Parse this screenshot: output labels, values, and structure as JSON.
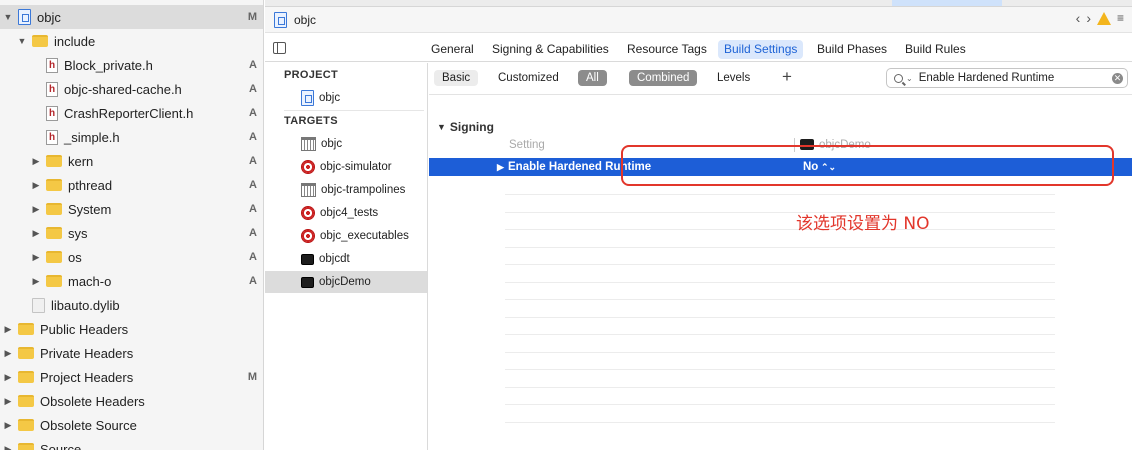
{
  "navigator": {
    "items": [
      {
        "label": "objc",
        "badge": "M",
        "icon": "project-icon",
        "indent": 0,
        "disclosure": "▼",
        "selected": true
      },
      {
        "label": "include",
        "badge": "",
        "icon": "folder-icon",
        "indent": 1,
        "disclosure": "▼"
      },
      {
        "label": "Block_private.h",
        "badge": "A",
        "icon": "header-file-icon",
        "indent": 2,
        "disclosure": ""
      },
      {
        "label": "objc-shared-cache.h",
        "badge": "A",
        "icon": "header-file-icon",
        "indent": 2,
        "disclosure": ""
      },
      {
        "label": "CrashReporterClient.h",
        "badge": "A",
        "icon": "header-file-icon",
        "indent": 2,
        "disclosure": ""
      },
      {
        "label": "_simple.h",
        "badge": "A",
        "icon": "header-file-icon",
        "indent": 2,
        "disclosure": ""
      },
      {
        "label": "kern",
        "badge": "A",
        "icon": "folder-icon",
        "indent": 2,
        "disclosure": "▶"
      },
      {
        "label": "pthread",
        "badge": "A",
        "icon": "folder-icon",
        "indent": 2,
        "disclosure": "▶"
      },
      {
        "label": "System",
        "badge": "A",
        "icon": "folder-icon",
        "indent": 2,
        "disclosure": "▶"
      },
      {
        "label": "sys",
        "badge": "A",
        "icon": "folder-icon",
        "indent": 2,
        "disclosure": "▶"
      },
      {
        "label": "os",
        "badge": "A",
        "icon": "folder-icon",
        "indent": 2,
        "disclosure": "▶"
      },
      {
        "label": "mach-o",
        "badge": "A",
        "icon": "folder-icon",
        "indent": 2,
        "disclosure": "▶"
      },
      {
        "label": "libauto.dylib",
        "badge": "",
        "icon": "library-icon",
        "indent": 1,
        "disclosure": ""
      },
      {
        "label": "Public Headers",
        "badge": "",
        "icon": "folder-icon",
        "indent": 0,
        "disclosure": "▶"
      },
      {
        "label": "Private Headers",
        "badge": "",
        "icon": "folder-icon",
        "indent": 0,
        "disclosure": "▶"
      },
      {
        "label": "Project Headers",
        "badge": "M",
        "icon": "folder-icon",
        "indent": 0,
        "disclosure": "▶"
      },
      {
        "label": "Obsolete Headers",
        "badge": "",
        "icon": "folder-icon",
        "indent": 0,
        "disclosure": "▶"
      },
      {
        "label": "Obsolete Source",
        "badge": "",
        "icon": "folder-icon",
        "indent": 0,
        "disclosure": "▶"
      },
      {
        "label": "Source",
        "badge": "",
        "icon": "folder-icon",
        "indent": 0,
        "disclosure": "▶"
      }
    ]
  },
  "jumpbar": {
    "title": "objc",
    "back_icon": "chevron-left-icon",
    "forward_icon": "chevron-right-icon",
    "warning_icon": "warning-icon",
    "menu_icon": "lines-icon"
  },
  "tabs": [
    {
      "label": "General",
      "active": false
    },
    {
      "label": "Signing & Capabilities",
      "active": false
    },
    {
      "label": "Resource Tags",
      "active": false
    },
    {
      "label": "Build Settings",
      "active": true
    },
    {
      "label": "Build Phases",
      "active": false
    },
    {
      "label": "Build Rules",
      "active": false
    }
  ],
  "targets_panel": {
    "project_header": "PROJECT",
    "project": {
      "label": "objc",
      "icon": "project-icon"
    },
    "targets_header": "TARGETS",
    "targets": [
      {
        "label": "objc",
        "icon": "framework-icon",
        "selected": false
      },
      {
        "label": "objc-simulator",
        "icon": "target-icon",
        "selected": false
      },
      {
        "label": "objc-trampolines",
        "icon": "framework-icon",
        "selected": false
      },
      {
        "label": "objc4_tests",
        "icon": "target-icon",
        "selected": false
      },
      {
        "label": "objc_executables",
        "icon": "target-icon",
        "selected": false
      },
      {
        "label": "objcdt",
        "icon": "terminal-icon",
        "selected": false
      },
      {
        "label": "objcDemo",
        "icon": "terminal-icon",
        "selected": true
      }
    ]
  },
  "filters": {
    "basic": "Basic",
    "customized": "Customized",
    "all": "All",
    "combined": "Combined",
    "levels": "Levels",
    "add": "+"
  },
  "search": {
    "value": "Enable Hardened Runtime",
    "clear": "✕"
  },
  "settings": {
    "group_title": "Signing",
    "column_setting": "Setting",
    "column_target": "objcDemo",
    "row": {
      "name": "Enable Hardened Runtime",
      "value": "No"
    }
  },
  "annotation": {
    "text": "该选项设置为 NO",
    "color": "#e2362b"
  },
  "colors": {
    "selection_blue": "#1d5ed7",
    "active_tab_bg": "#dbe8fc",
    "active_tab_text": "#1e63d6",
    "annotation_red": "#e2362b"
  }
}
